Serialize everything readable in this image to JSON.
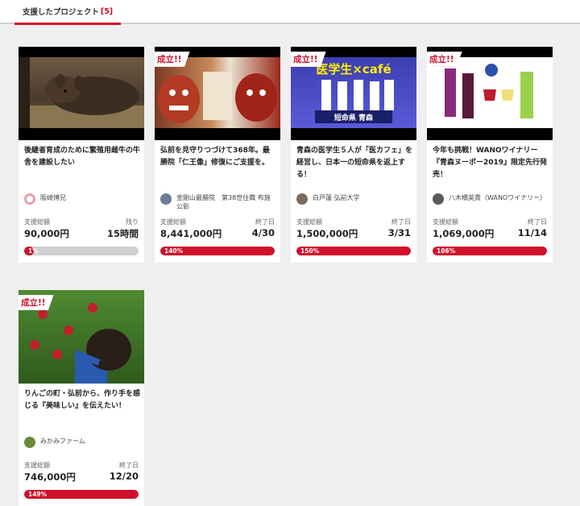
{
  "tab": {
    "label": "支援したプロジェクト",
    "count": "[5]"
  },
  "cards": [
    {
      "title": "後継者育成のために繁殖用雌牛の牛舎を建設したい",
      "owner": "阪崎博兄",
      "funded_label": "支援総額",
      "funded": "90,000円",
      "right_label": "残り",
      "right_value": "15時間",
      "progress_label": "1%",
      "progress": 0.01,
      "success": false
    },
    {
      "title": "弘前を見守りつづけて368年。最勝院「仁王像」修復にご支援を。",
      "owner": "金剛山最勝院　第38世住職 布施公彰",
      "funded_label": "支援総額",
      "funded": "8,441,000円",
      "right_label": "終了日",
      "right_value": "4/30",
      "progress_label": "140%",
      "progress": 1.0,
      "success": true,
      "badge": "成立!!"
    },
    {
      "title": "青森の医学生５人が「医カフェ」を経営し、日本一の短命県を返上する！",
      "owner": "白戸蓮 弘前大学",
      "funded_label": "支援総額",
      "funded": "1,500,000円",
      "right_label": "終了日",
      "right_value": "3/31",
      "progress_label": "150%",
      "progress": 1.0,
      "success": true,
      "badge": "成立!!",
      "thumb_text_1": "医学生×café",
      "thumb_text_2": "短命県 青森"
    },
    {
      "title": "今年も挑戦！WANOワイナリー『青森ヌーボー2019』限定先行発売！",
      "owner": "八木橋英貴（WANOワイナリー）",
      "funded_label": "支援総額",
      "funded": "1,069,000円",
      "right_label": "終了日",
      "right_value": "11/14",
      "progress_label": "106%",
      "progress": 1.0,
      "success": true,
      "badge": "成立!!"
    },
    {
      "title": "りんごの町・弘前から、作り手を感じる『美味しい』を伝えたい！",
      "owner": "みかみファーム",
      "funded_label": "支援総額",
      "funded": "746,000円",
      "right_label": "終了日",
      "right_value": "12/20",
      "progress_label": "149%",
      "progress": 1.0,
      "success": true,
      "badge": "成立!!"
    }
  ],
  "colors": {
    "accent": "#d0112b",
    "track": "#cfcfcf"
  }
}
